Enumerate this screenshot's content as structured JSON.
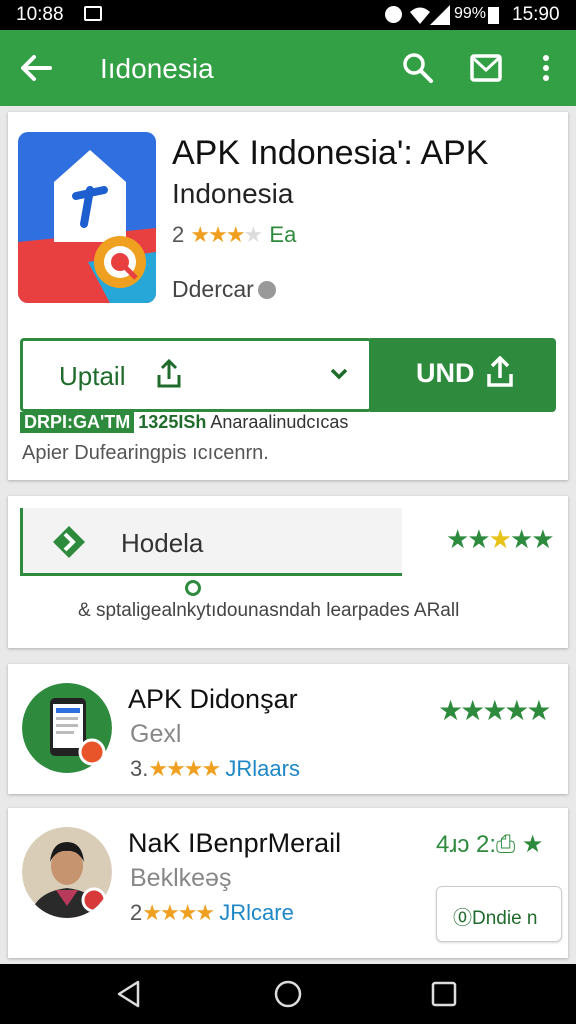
{
  "status_bar": {
    "time_left": "10:88",
    "battery_pct": "99%",
    "time_right": "15:90"
  },
  "app_bar": {
    "title": "Iıdonesia"
  },
  "header": {
    "title": "APK Indonesia': APK",
    "subtitle": "Indonesia",
    "rating_value": "2",
    "rating_stars": "★★★",
    "rating_dim": "★",
    "rating_suffix": "Ea",
    "developer": "Ddercar",
    "detail_button_label": "Uptail",
    "install_button_label": "UND",
    "meta_badge": "DRPI:GA'TM",
    "meta_number": "1325ISh",
    "meta_text": "Anaraalinudcıcas",
    "description": "Apier Dufearingpis ıcıcenrn."
  },
  "promo": {
    "label": "Hodela",
    "stars_green": "★★",
    "stars_yellow": "★",
    "stars_tail": "★★",
    "description": "&  sptaligealnkytıdounasndah learpades ARall"
  },
  "items": [
    {
      "name": "APK Didonşar",
      "category": "Gexl",
      "rating": "3.",
      "stars": "★★★★",
      "label": "JRlaars",
      "right_stars": "★★★★★"
    },
    {
      "name": "NaK IBenprMerail",
      "category": "Beklkeəş",
      "rating": "2",
      "stars": "★★★★",
      "label": "JRlcare",
      "stats": "4ɹɔ 2:⎙ ★",
      "button_label": "⓪Dndie n"
    }
  ],
  "colors": {
    "primary_green": "#33a045",
    "dark_green": "#2e8b3e",
    "star_gold": "#f0a020",
    "link_blue": "#1e88c7"
  }
}
